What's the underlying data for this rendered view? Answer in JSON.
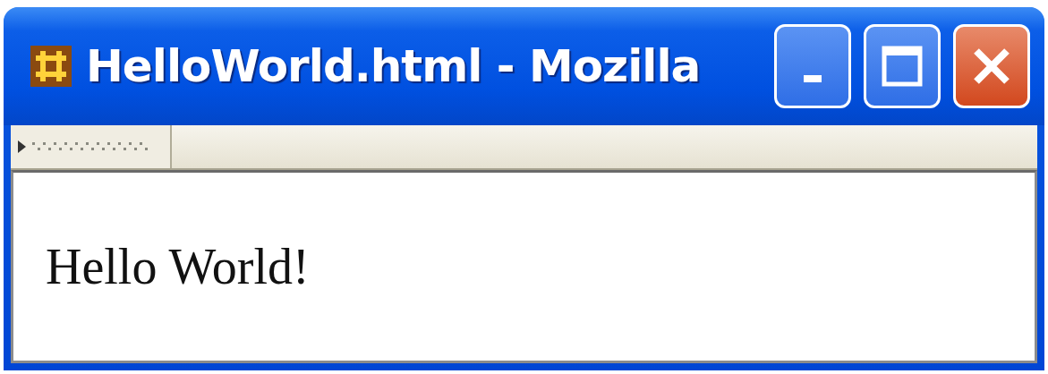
{
  "window": {
    "title": "HelloWorld.html - Mozilla"
  },
  "content": {
    "text": "Hello World!"
  }
}
